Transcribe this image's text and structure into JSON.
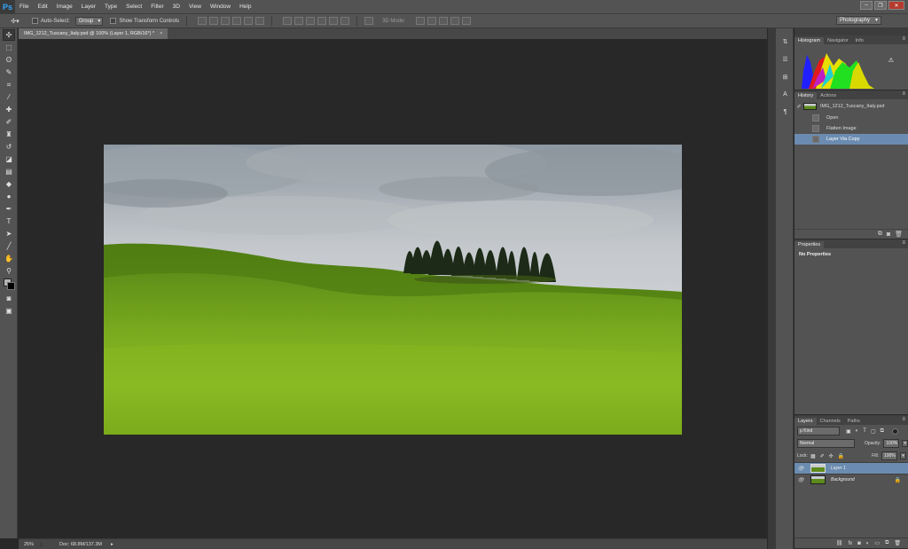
{
  "app": {
    "logo": "Ps"
  },
  "menu": [
    "File",
    "Edit",
    "Image",
    "Layer",
    "Type",
    "Select",
    "Filter",
    "3D",
    "View",
    "Window",
    "Help"
  ],
  "window_controls": {
    "minimize": "–",
    "restore": "❐",
    "close": "✕"
  },
  "options": {
    "auto_select_label": "Auto-Select:",
    "auto_select_target": "Group",
    "transform_label": "Show Transform Controls",
    "mode3d_label": "3D Mode:",
    "workspace": "Photography"
  },
  "document": {
    "tab_title": "IMG_1212_Tuscany_Italy.psd @ 100% (Layer 1, RGB/16*) *",
    "close": "×"
  },
  "status": {
    "zoom": "25%",
    "doc_size": "Doc: 68.8M/137.3M",
    "arrow": "▸"
  },
  "panels": {
    "histogram_tabs": [
      "Histogram",
      "Navigator",
      "Info"
    ],
    "history_tabs": [
      "History",
      "Actions"
    ],
    "properties_tab": "Properties",
    "properties_body": "No Properties",
    "layers_tabs": [
      "Layers",
      "Channels",
      "Paths"
    ],
    "menu_glyph": "≡",
    "warning_glyph": "⚠"
  },
  "history": {
    "snapshot": "IMG_1212_Tuscany_Italy.psd",
    "states": [
      "Open",
      "Flatten Image",
      "Layer Via Copy"
    ],
    "selected_index": 2
  },
  "layers": {
    "kind_label": "ρ Kind",
    "blend_mode": "Normal",
    "opacity_label": "Opacity:",
    "opacity_value": "100%",
    "lock_label": "Lock:",
    "fill_label": "Fill:",
    "fill_value": "100%",
    "items": [
      {
        "name": "Layer 1",
        "visible": true,
        "selected": true
      },
      {
        "name": "Background",
        "visible": true,
        "selected": false,
        "locked": true
      }
    ]
  },
  "colors": {
    "selection_blue": "#6b8cb0",
    "ps_blue": "#31a8ff",
    "panel_gray": "#535353",
    "canvas_bg": "#282828"
  }
}
